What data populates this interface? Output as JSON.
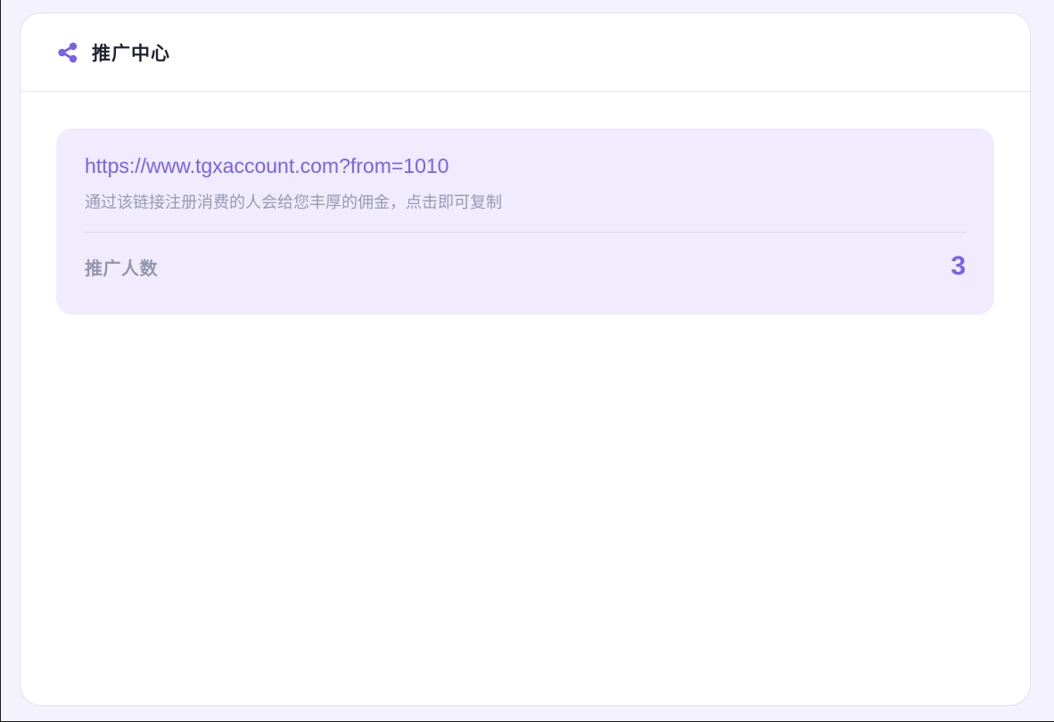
{
  "header": {
    "icon": "share-icon",
    "title": "推广中心"
  },
  "promo": {
    "link": "https://www.tgxaccount.com?from=1010",
    "description": "通过该链接注册消费的人会给您丰厚的佣金，点击即可复制",
    "stats_label": "推广人数",
    "stats_value": "3"
  },
  "colors": {
    "accent": "#7b61e8",
    "promo_bg": "#f0ebfd",
    "muted_text": "#969bb3",
    "page_bg": "#f4f2fd"
  }
}
